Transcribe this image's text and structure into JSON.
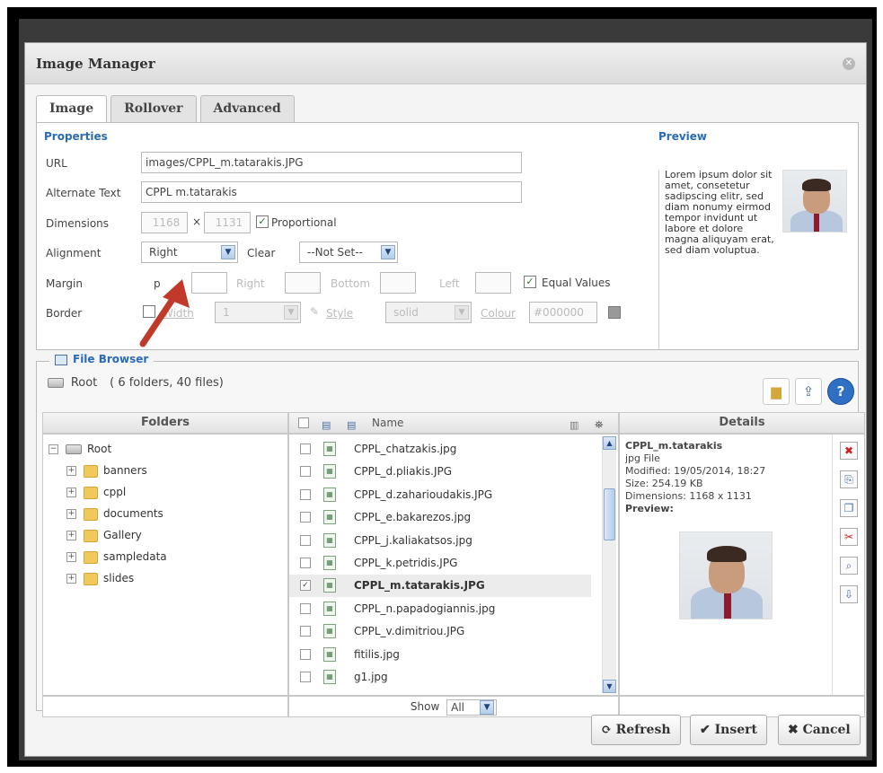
{
  "dialog": {
    "title": "Image Manager",
    "tabs": [
      {
        "label": "Image"
      },
      {
        "label": "Rollover"
      },
      {
        "label": "Advanced"
      }
    ]
  },
  "properties": {
    "section_title": "Properties",
    "url_label": "URL",
    "url_value": "images/CPPL_m.tatarakis.JPG",
    "alt_label": "Alternate Text",
    "alt_value": "CPPL m.tatarakis",
    "dimensions_label": "Dimensions",
    "width_value": "1168",
    "times": "×",
    "height_value": "1131",
    "proportional_label": "Proportional",
    "alignment_label": "Alignment",
    "alignment_value": "Right",
    "clear_label": "Clear",
    "clear_value": "--Not Set--",
    "margin_label": "Margin",
    "margin_top_label": "p",
    "margin_right_label": "Right",
    "margin_bottom_label": "Bottom",
    "margin_left_label": "Left",
    "equal_values_label": "Equal Values",
    "border_label": "Border",
    "border_width_label": "Width",
    "border_width_value": "1",
    "border_style_label": "Style",
    "border_style_value": "solid",
    "border_colour_label": "Colour",
    "border_colour_value": "#000000"
  },
  "preview": {
    "title": "Preview",
    "lorem": "Lorem ipsum dolor sit amet, consetetur sadipscing elitr, sed diam nonumy eirmod tempor invidunt ut labore et dolore magna aliquyam erat, sed diam voluptua."
  },
  "file_browser": {
    "legend": "File Browser",
    "root_label": "Root",
    "root_summary": "( 6 folders, 40 files)",
    "folders_header": "Folders",
    "name_header": "Name",
    "details_header": "Details",
    "tree_root": "Root",
    "folders": [
      "banners",
      "cppl",
      "documents",
      "Gallery",
      "sampledata",
      "slides"
    ],
    "files": [
      {
        "name": "CPPL_chatzakis.jpg",
        "selected": false
      },
      {
        "name": "CPPL_d.pliakis.JPG",
        "selected": false
      },
      {
        "name": "CPPL_d.zaharioudakis.JPG",
        "selected": false
      },
      {
        "name": "CPPL_e.bakarezos.jpg",
        "selected": false
      },
      {
        "name": "CPPL_j.kaliakatsos.jpg",
        "selected": false
      },
      {
        "name": "CPPL_k.petridis.JPG",
        "selected": false
      },
      {
        "name": "CPPL_m.tatarakis.JPG",
        "selected": true
      },
      {
        "name": "CPPL_n.papadogiannis.jpg",
        "selected": false
      },
      {
        "name": "CPPL_v.dimitriou.JPG",
        "selected": false
      },
      {
        "name": "fitilis.jpg",
        "selected": false
      },
      {
        "name": "g1.jpg",
        "selected": false
      }
    ],
    "show_label": "Show",
    "show_value": "All",
    "details": {
      "name": "CPPL_m.tatarakis",
      "type": "jpg File",
      "modified": "Modified: 19/05/2014, 18:27",
      "size": "Size: 254.19 KB",
      "dimensions": "Dimensions: 1168 x 1131",
      "preview_label": "Preview:"
    }
  },
  "footer": {
    "refresh_label": "Refresh",
    "insert_label": "Insert",
    "cancel_label": "Cancel"
  },
  "colors": {
    "accent": "#2a6bb6",
    "arrow": "#c0392b"
  }
}
